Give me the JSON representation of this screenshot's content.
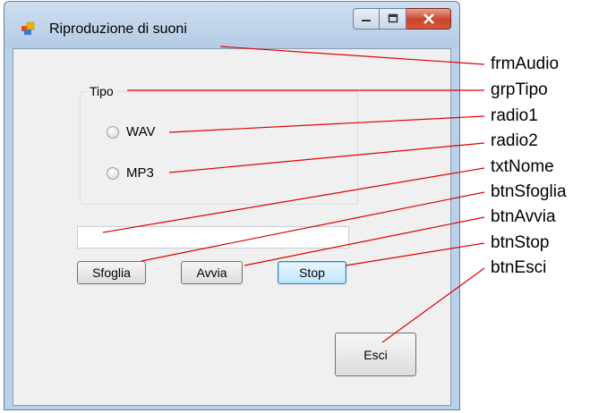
{
  "window": {
    "title": "Riproduzione di suoni"
  },
  "group": {
    "label": "Tipo",
    "radios": [
      "WAV",
      "MP3"
    ]
  },
  "textbox": {
    "value": ""
  },
  "buttons": {
    "browse": "Sfoglia",
    "play": "Avvia",
    "stop": "Stop",
    "exit": "Esci"
  },
  "annotations": [
    "frmAudio",
    "grpTipo",
    "radio1",
    "radio2",
    "txtNome",
    "btnSfoglia",
    "btnAvvia",
    "btnStop",
    "btnEsci"
  ],
  "colors": {
    "leader_lines": "#e00000",
    "client_background": "#f0f0f0",
    "close_button": "#c9442b"
  }
}
